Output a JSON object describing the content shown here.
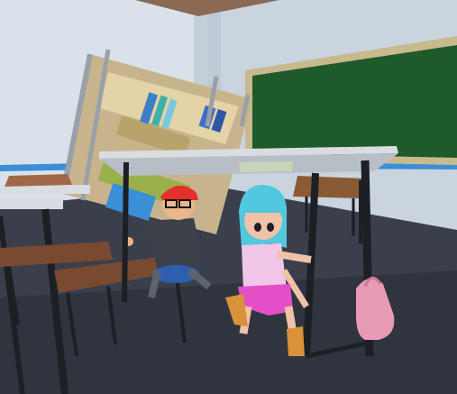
{
  "scene": {
    "kind": "3d-classroom",
    "colors": {
      "ceiling": "#8a6a52",
      "wall": "#d9e2ea",
      "wall_shadow": "#b8c3cf",
      "floor": "#3a3f4b",
      "blue_stripe": "#3a8fd6",
      "chalkboard": "#1f5a2a",
      "chalkboard_frame": "#c8b98f",
      "shelf_frame": "#9aa0a8",
      "desk_top": "#d9dde2",
      "desk_leg": "#1c1f24",
      "wood": "#7a4a30",
      "teen_girl_hair": "#52c8df",
      "girl_top": "#f2c6e8",
      "girl_shorts": "#e44fc8",
      "boy_cap": "#e2312a",
      "boy_jacket": "#3c4048",
      "backpack": "#e79bb7"
    },
    "entities": [
      {
        "name": "bookshelf",
        "state": "tipped-over"
      },
      {
        "name": "chalkboard",
        "state": "on-wall"
      },
      {
        "name": "desk-front",
        "state": "sheltering-girl"
      },
      {
        "name": "girl",
        "state": "crouching-under-desk"
      },
      {
        "name": "boy",
        "state": "crouching-behind-desk"
      },
      {
        "name": "backpack",
        "state": "hanging-on-desk"
      }
    ]
  }
}
